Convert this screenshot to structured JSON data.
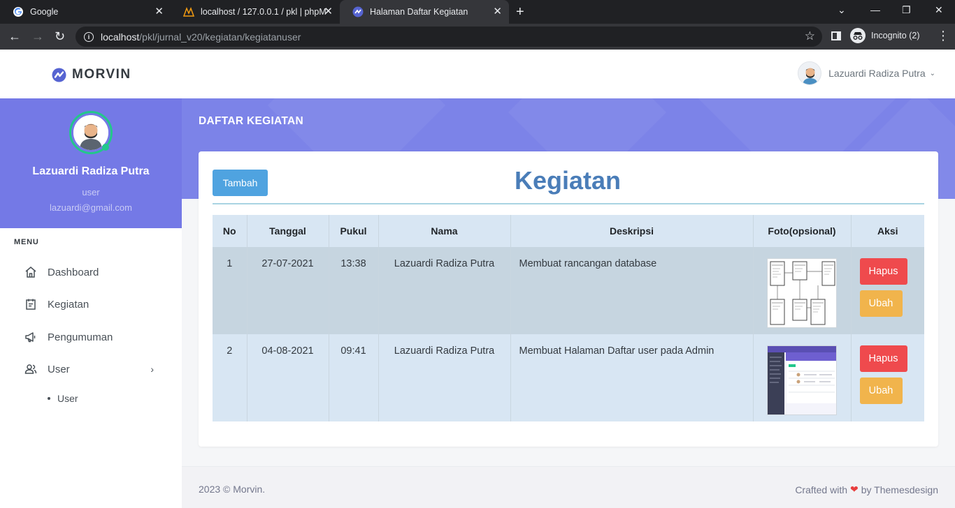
{
  "browser": {
    "tabs": [
      {
        "label": "Google",
        "icon": "google-icon",
        "active": false
      },
      {
        "label": "localhost / 127.0.0.1 / pkl | phpMyAdmin",
        "icon": "phpmyadmin-icon",
        "active": false
      },
      {
        "label": "Halaman Daftar Kegiatan",
        "icon": "morvin-icon",
        "active": true
      }
    ],
    "url_host": "localhost",
    "url_path": "/pkl/jurnal_v20/kegiatan/kegiatanuser",
    "incognito_label": "Incognito (2)"
  },
  "header": {
    "brand": "MORVIN",
    "user_name": "Lazuardi Radiza Putra"
  },
  "sidebar": {
    "profile_name": "Lazuardi Radiza Putra",
    "profile_role": "user",
    "profile_email": "lazuardi@gmail.com",
    "menu_title": "MENU",
    "items": [
      {
        "label": "Dashboard",
        "icon": "home-icon"
      },
      {
        "label": "Kegiatan",
        "icon": "calendar-icon"
      },
      {
        "label": "Pengumuman",
        "icon": "megaphone-icon"
      },
      {
        "label": "User",
        "icon": "users-icon"
      }
    ],
    "sub_items": [
      {
        "label": "User"
      }
    ]
  },
  "main": {
    "page_title": "DAFTAR KEGIATAN",
    "add_button": "Tambah",
    "heading": "Kegiatan",
    "table": {
      "headers": [
        "No",
        "Tanggal",
        "Pukul",
        "Nama",
        "Deskripsi",
        "Foto(opsional)",
        "Aksi"
      ],
      "rows": [
        {
          "no": "1",
          "tanggal": "27-07-2021",
          "pukul": "13:38",
          "nama": "Lazuardi Radiza Putra",
          "deskripsi": "Membuat rancangan database",
          "foto": "database-diagram-thumbnail",
          "hapus": "Hapus",
          "ubah": "Ubah"
        },
        {
          "no": "2",
          "tanggal": "04-08-2021",
          "pukul": "09:41",
          "nama": "Lazuardi Radiza Putra",
          "deskripsi": "Membuat Halaman Daftar user pada Admin",
          "foto": "admin-page-screenshot-thumbnail",
          "hapus": "Hapus",
          "ubah": "Ubah"
        }
      ]
    }
  },
  "footer": {
    "copyright": "2023 © Morvin.",
    "crafted_prefix": "Crafted with",
    "crafted_suffix": "by Themesdesign"
  },
  "colors": {
    "banner": "#7c83e8",
    "primary_button": "#4fa3e0",
    "danger": "#ef4a4d",
    "warning": "#f1b44c",
    "heading": "#4a7db8"
  }
}
